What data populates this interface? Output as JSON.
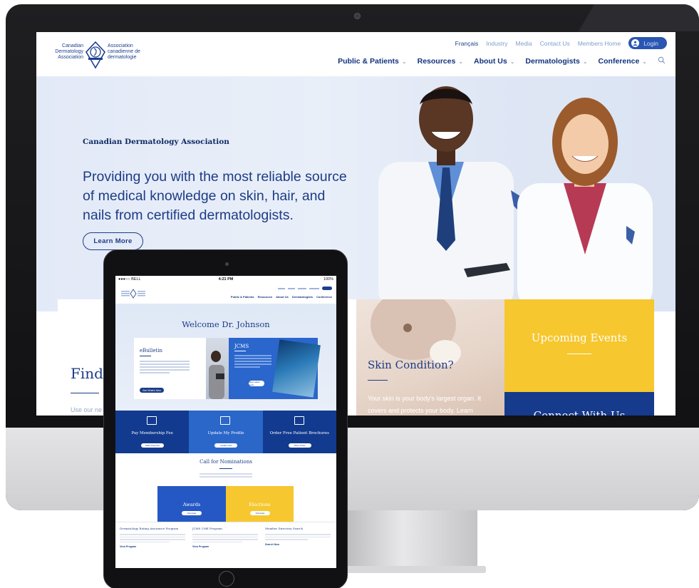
{
  "desktop": {
    "logo": {
      "left_lines": [
        "Canadian",
        "Dermatology",
        "Association"
      ],
      "right_lines": [
        "Association",
        "canadienne de",
        "dermatologie"
      ]
    },
    "util_nav": {
      "francais": "Français",
      "industry": "Industry",
      "media": "Media",
      "contact": "Contact Us",
      "members_home": "Members Home",
      "login": "Login"
    },
    "main_nav": [
      {
        "label": "Public & Patients"
      },
      {
        "label": "Resources"
      },
      {
        "label": "About Us"
      },
      {
        "label": "Dermatologists"
      },
      {
        "label": "Conference"
      }
    ],
    "hero": {
      "eyebrow": "Canadian Dermatology Association",
      "title": "Providing you with the most reliable source of medical knowledge on skin, hair, and nails from certified dermatologists.",
      "button": "Learn More"
    },
    "tiles": {
      "find_title": "Find",
      "find_text": "Use our ne",
      "skin_title": "Skin Condition?",
      "skin_text": "Your skin is your body's largest organ. It covers and protects your body. Learn",
      "events_title": "Upcoming Events",
      "connect_title": "Connect With Us"
    }
  },
  "tablet": {
    "status": {
      "carrier": "●●●○○ BELL",
      "time": "4:21 PM",
      "battery": "100%"
    },
    "welcome_title": "Welcome Dr. Johnson",
    "ebulletin": {
      "title": "eBulletin",
      "button": "See What's New"
    },
    "jcms": {
      "title": "JCMS",
      "button": "View Latest Issue"
    },
    "actions": [
      {
        "label": "Pay Membership Fee",
        "button": "Make Payment",
        "color": "#123a8f"
      },
      {
        "label": "Update My Profile",
        "button": "Update Now",
        "color": "#2b66c9"
      },
      {
        "label": "Order Free Patient Brochures",
        "button": "Place Order",
        "color": "#123a8f"
      }
    ],
    "nominations": {
      "title": "Call for Nominations",
      "awards": "Awards",
      "awards_button": "Nominate",
      "elections": "Elections",
      "elections_button": "Nominate"
    },
    "programs": [
      {
        "title": "Dermatology Rating Assurance Program",
        "more": "View Program"
      },
      {
        "title": "JCMS CME Program",
        "more": "View Program"
      },
      {
        "title": "Member Directory Search",
        "more": "Search Now"
      }
    ]
  },
  "colors": {
    "navy": "#12337f",
    "accent_yellow": "#f6c72e",
    "accent_blue": "#2a66cc"
  }
}
